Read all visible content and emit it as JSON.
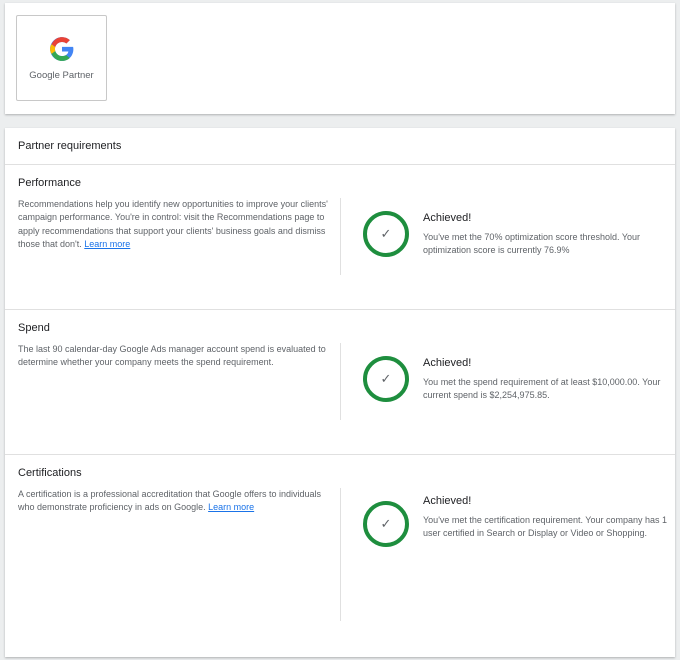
{
  "logo": {
    "text": "Google Partner"
  },
  "requirements": {
    "title": "Partner requirements",
    "sections": [
      {
        "title": "Performance",
        "description": "Recommendations help you identify new opportunities to improve your clients' campaign performance. You're in control: visit the Recommendations page to apply recommendations that support your clients' business goals and dismiss those that don't.",
        "link": "Learn more",
        "status": "Achieved!",
        "status_detail": "You've met the 70% optimization score threshold. Your optimization score is currently 76.9%"
      },
      {
        "title": "Spend",
        "description": "The last 90 calendar-day Google Ads manager account spend is evaluated to determine whether your company meets the spend requirement.",
        "status": "Achieved!",
        "status_detail": "You met the spend requirement of at least $10,000.00. Your current spend is $2,254,975.85."
      },
      {
        "title": "Certifications",
        "description": "A certification is a professional accreditation that Google offers to individuals who demonstrate proficiency in ads on Google.",
        "link": "Learn more",
        "status": "Achieved!",
        "status_detail": "You've met the certification requirement. Your company has 1 user certified in Search or Display or Video or Shopping."
      }
    ]
  },
  "colors": {
    "achieved": "#1e8e3e",
    "link": "#1a73e8"
  }
}
